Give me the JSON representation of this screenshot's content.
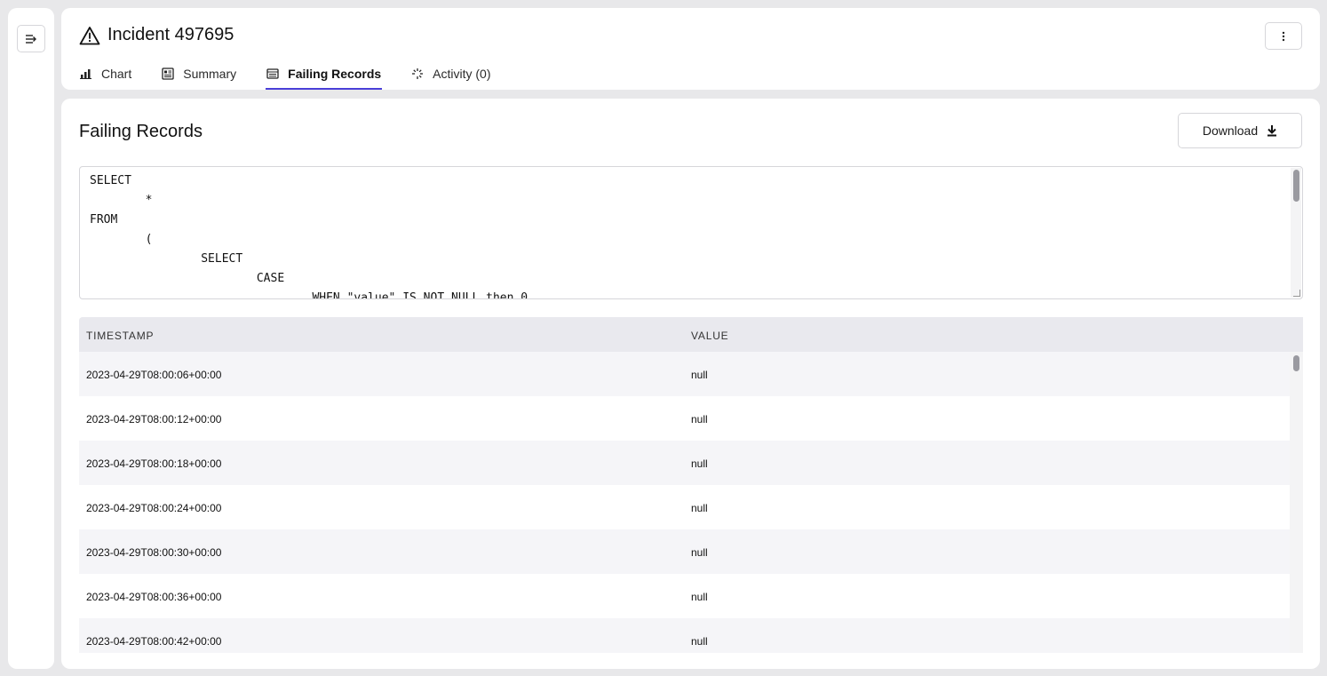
{
  "header": {
    "title": "Incident 497695",
    "tabs": [
      {
        "label": "Chart",
        "icon": "bar-chart-icon",
        "active": false
      },
      {
        "label": "Summary",
        "icon": "summary-doc-icon",
        "active": false
      },
      {
        "label": "Failing Records",
        "icon": "table-icon",
        "active": true
      },
      {
        "label": "Activity (0)",
        "icon": "activity-icon",
        "active": false
      }
    ]
  },
  "main": {
    "section_title": "Failing Records",
    "download_label": "Download",
    "sql": "SELECT\n        *\nFROM\n        (\n                SELECT\n                        CASE\n                                WHEN \"value\" IS NOT NULL then 0"
  },
  "table": {
    "columns": [
      "TIMESTAMP",
      "VALUE"
    ],
    "rows": [
      [
        "2023-04-29T08:00:06+00:00",
        "null"
      ],
      [
        "2023-04-29T08:00:12+00:00",
        "null"
      ],
      [
        "2023-04-29T08:00:18+00:00",
        "null"
      ],
      [
        "2023-04-29T08:00:24+00:00",
        "null"
      ],
      [
        "2023-04-29T08:00:30+00:00",
        "null"
      ],
      [
        "2023-04-29T08:00:36+00:00",
        "null"
      ],
      [
        "2023-04-29T08:00:42+00:00",
        "null"
      ]
    ]
  },
  "colors": {
    "accent": "#4a3fd8",
    "header_bg": "#e9e9ee",
    "alt_row_bg": "#f5f5f8",
    "page_bg": "#e8e8ea"
  }
}
